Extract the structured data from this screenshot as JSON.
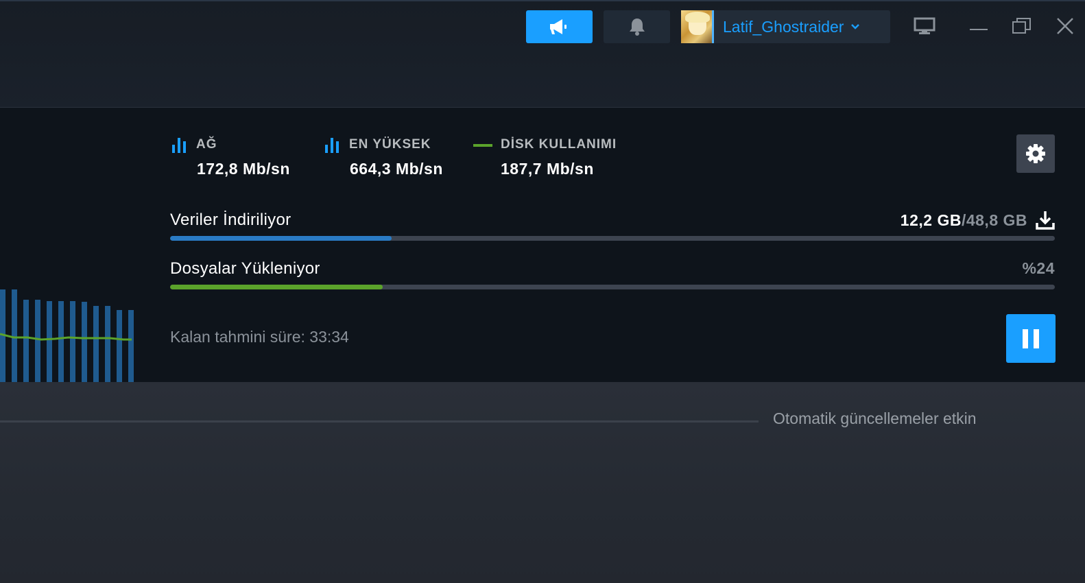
{
  "header": {
    "username": "Latif_Ghostraider",
    "icons": {
      "announce": "megaphone-icon",
      "notifications": "bell-icon",
      "user_menu": "chevron-down-icon",
      "big_picture": "monitor-icon",
      "minimize": "minimize-icon",
      "maximize": "restore-icon",
      "close": "close-icon"
    },
    "colors": {
      "accent": "#1a9fff"
    }
  },
  "stats": {
    "network": {
      "label": "AĞ",
      "value": "172,8 Mb/sn",
      "icon": "bar-chart-icon"
    },
    "peak": {
      "label": "EN YÜKSEK",
      "value": "664,3 Mb/sn",
      "icon": "bar-chart-icon"
    },
    "disk": {
      "label": "DİSK KULLANIMI",
      "value": "187,7 Mb/sn",
      "icon": "line-legend-icon",
      "color": "#5ba32b"
    }
  },
  "download": {
    "title": "Veriler İndiriliyor",
    "done": "12,2 GB",
    "separator": "/",
    "total": "48,8 GB",
    "progress": 0.25,
    "icon": "download-icon",
    "bar_color": "#2a7bc4"
  },
  "files": {
    "title": "Dosyalar Yükleniyor",
    "percent_text": "%24",
    "progress": 0.24,
    "bar_color": "#5ba32b"
  },
  "eta": "Kalan tahmini süre: 33:34",
  "buttons": {
    "settings_icon": "gear-icon",
    "pause_icon": "pause-icon"
  },
  "footer": {
    "auto_updates": "Otomatik güncellemeler etkin"
  }
}
